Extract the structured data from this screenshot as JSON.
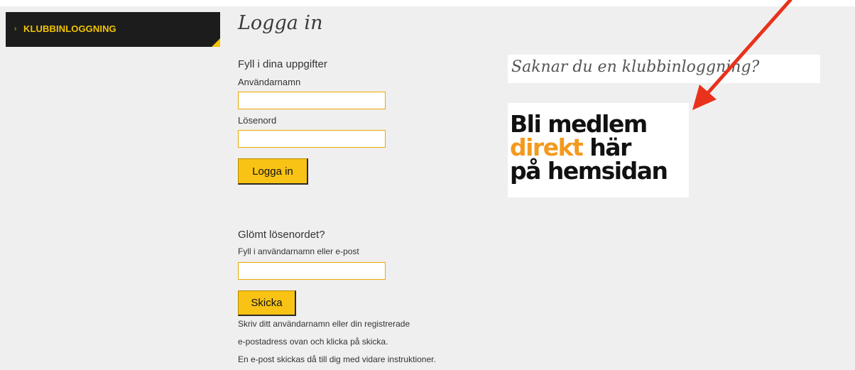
{
  "sidebar": {
    "items": [
      {
        "label": "KLUBBINLOGGNING",
        "icon": "chevron-right-icon",
        "active": true
      }
    ]
  },
  "login": {
    "title": "Logga in",
    "subtitle": "Fyll i dina uppgifter",
    "username_label": "Användarnamn",
    "username_value": "",
    "password_label": "Lösenord",
    "password_value": "",
    "submit_label": "Logga in"
  },
  "forgot": {
    "heading": "Glömt lösenordet?",
    "field_label": "Fyll i användarnamn eller e-post",
    "field_value": "",
    "submit_label": "Skicka",
    "help_lines": [
      "Skriv ditt användarnamn eller din registrerade",
      "e-postadress ovan och klicka på skicka.",
      "En e-post skickas då till dig med vidare instruktioner."
    ]
  },
  "promo": {
    "heading": "Saknar du en klubbinloggning?",
    "banner": {
      "line1": "Bli medlem",
      "line2_accent": "direkt",
      "line2_rest": " här",
      "line3": "på hemsidan"
    },
    "arrow_icon": "red-arrow-icon"
  },
  "colors": {
    "accent_yellow": "#f8c315",
    "sidebar_bg": "#1c1c1c",
    "sidebar_text": "#f3c400",
    "input_border": "#e9a800",
    "banner_orange": "#f39a1e",
    "arrow_red": "#e8321c",
    "page_bg": "#efefef"
  }
}
